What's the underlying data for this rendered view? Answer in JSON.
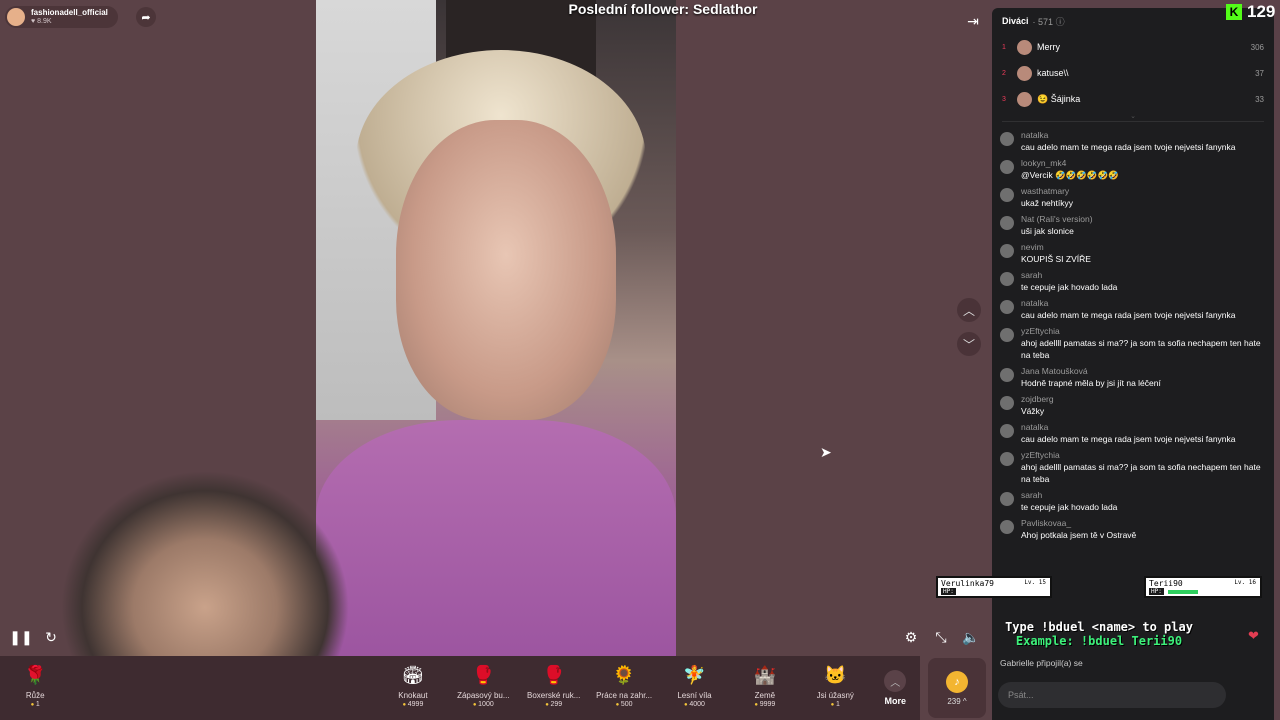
{
  "overlay": {
    "top_title": "Poslední follower: Sedlathor",
    "kick_count": "129",
    "kick_logo": "K",
    "duel": {
      "p1": "Verulinka79",
      "p1_lv": "Lv. 15",
      "p2": "Terii90",
      "p2_lv": "Lv. 16",
      "hp_label": "HP:",
      "line1": "Type !bduel <name> to play",
      "line2": "Example: !bduel Terii90"
    }
  },
  "stream": {
    "host": "fashionadell_official",
    "likes": "8.9K"
  },
  "viewers_panel": {
    "title": "Diváci",
    "count": "571",
    "top": [
      {
        "rank": "1",
        "name": "Merry",
        "score": "306"
      },
      {
        "rank": "2",
        "name": "katuse\\\\",
        "score": "37"
      },
      {
        "rank": "3",
        "name": "😉 Šájinka",
        "score": "33"
      }
    ]
  },
  "chat": [
    {
      "user": "natalka",
      "text": "cau adelo mam te mega rada jsem tvoje nejvetsi fanynka"
    },
    {
      "user": "lookyn_mk4",
      "text": "@Vercik 🤣🤣🤣🤣🤣🤣"
    },
    {
      "user": "wasthatmary",
      "text": "ukaž nehtíkyy"
    },
    {
      "user": "Nat (Rali's version)",
      "text": "uši jak slonice"
    },
    {
      "user": "nevim",
      "text": "KOUPIŠ SI ZVÍŘE"
    },
    {
      "user": "sarah",
      "text": "te cepuje jak hovado lada"
    },
    {
      "user": "natalka",
      "text": "cau adelo mam te mega rada jsem tvoje nejvetsi fanynka"
    },
    {
      "user": "yzEftychia",
      "text": "ahoj adellll pamatas si ma?? ja som ta sofia nechapem ten hate na teba"
    },
    {
      "user": "Jana Matoušková",
      "text": "Hodně trapné měla by jsi jít na léčení"
    },
    {
      "user": "zojdberg",
      "text": "Vážky"
    },
    {
      "user": "natalka",
      "text": "cau adelo mam te mega rada jsem tvoje nejvetsi fanynka"
    },
    {
      "user": "yzEftychia",
      "text": "ahoj adellll pamatas si ma?? ja som ta sofia nechapem ten hate na teba"
    },
    {
      "user": "sarah",
      "text": "te cepuje jak hovado lada"
    },
    {
      "user": "Pavliskovaa_",
      "text": "Ahoj potkala jsem tě v Ostravě"
    }
  ],
  "joined": {
    "user": "Gabrielle",
    "text": "připojil(a) se"
  },
  "input": {
    "placeholder": "Psát..."
  },
  "gifts": [
    {
      "name": "Růže",
      "price": "1",
      "icon": "🌹"
    },
    {
      "name": "Knokaut",
      "price": "4999",
      "icon": "🏟"
    },
    {
      "name": "Zápasový bu...",
      "price": "1000",
      "icon": "🥊"
    },
    {
      "name": "Boxerské ruk...",
      "price": "299",
      "icon": "🥊"
    },
    {
      "name": "Práce na zahr...",
      "price": "500",
      "icon": "🌻"
    },
    {
      "name": "Lesní víla",
      "price": "4000",
      "icon": "🧚"
    },
    {
      "name": "Země",
      "price": "9999",
      "icon": "🏰"
    },
    {
      "name": "Jsi úžasný",
      "price": "1",
      "icon": "🐱"
    }
  ],
  "more_label": "More",
  "coins": {
    "value": "239 ^",
    "icon": "♪"
  }
}
